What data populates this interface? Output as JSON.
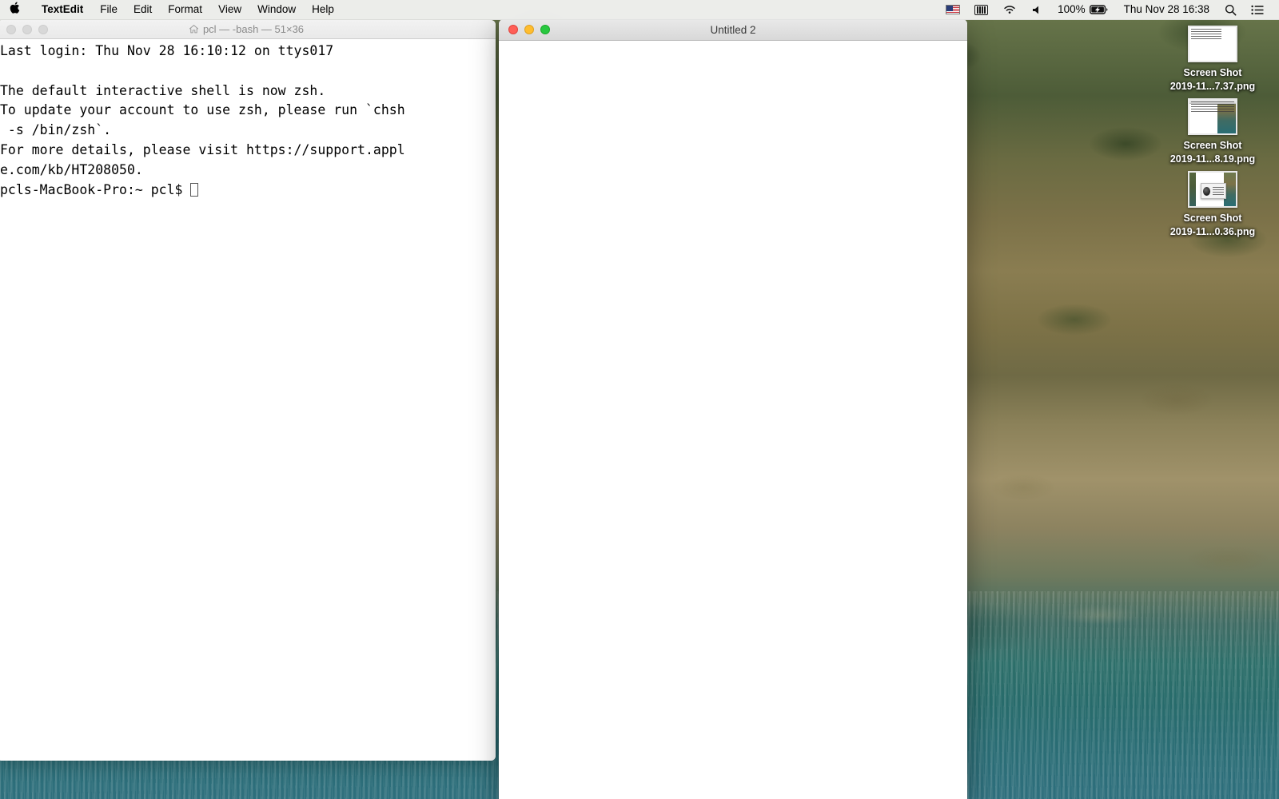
{
  "menubar": {
    "apple_logo": "",
    "app_name": "TextEdit",
    "items": [
      "File",
      "Edit",
      "Format",
      "View",
      "Window",
      "Help"
    ],
    "status": {
      "input_source_icon": "us-flag-icon",
      "keyboard_viewer_icon": "keyboard-icon",
      "wifi_icon": "wifi-icon",
      "volume_icon": "volume-icon",
      "battery_percent": "100%",
      "battery_icon": "battery-charging-icon",
      "clock": "Thu Nov 28  16:38",
      "search_icon": "search-icon",
      "control_center_icon": "control-center-icon"
    }
  },
  "terminal": {
    "title": "pcl — -bash — 51×36",
    "title_icon": "home-icon",
    "traffic_lights": [
      "close",
      "minimize",
      "zoom"
    ],
    "lines": [
      "Last login: Thu Nov 28 16:10:12 on ttys017",
      "",
      "The default interactive shell is now zsh.",
      "To update your account to use zsh, please run `chsh",
      " -s /bin/zsh`.",
      "For more details, please visit https://support.appl",
      "e.com/kb/HT208050."
    ],
    "prompt": "pcls-MacBook-Pro:~ pcl$ "
  },
  "textedit": {
    "title": "Untitled 2",
    "traffic_lights": [
      "close",
      "minimize",
      "zoom"
    ],
    "content": ""
  },
  "desktop": {
    "icons": [
      {
        "name_line1": "Screen Shot",
        "name_line2": "2019-11...7.37.png",
        "thumb": "t1"
      },
      {
        "name_line1": "Screen Shot",
        "name_line2": "2019-11...8.19.png",
        "thumb": "t2"
      },
      {
        "name_line1": "Screen Shot",
        "name_line2": "2019-11...0.36.png",
        "thumb": "t3"
      }
    ]
  },
  "colors": {
    "accent_red": "#ff5f57",
    "accent_yellow": "#ffbd2e",
    "accent_green": "#28c840",
    "menubar_bg": "#f6f6f6",
    "window_bg": "#ffffff",
    "inactive_light": "#d8d8d8"
  }
}
